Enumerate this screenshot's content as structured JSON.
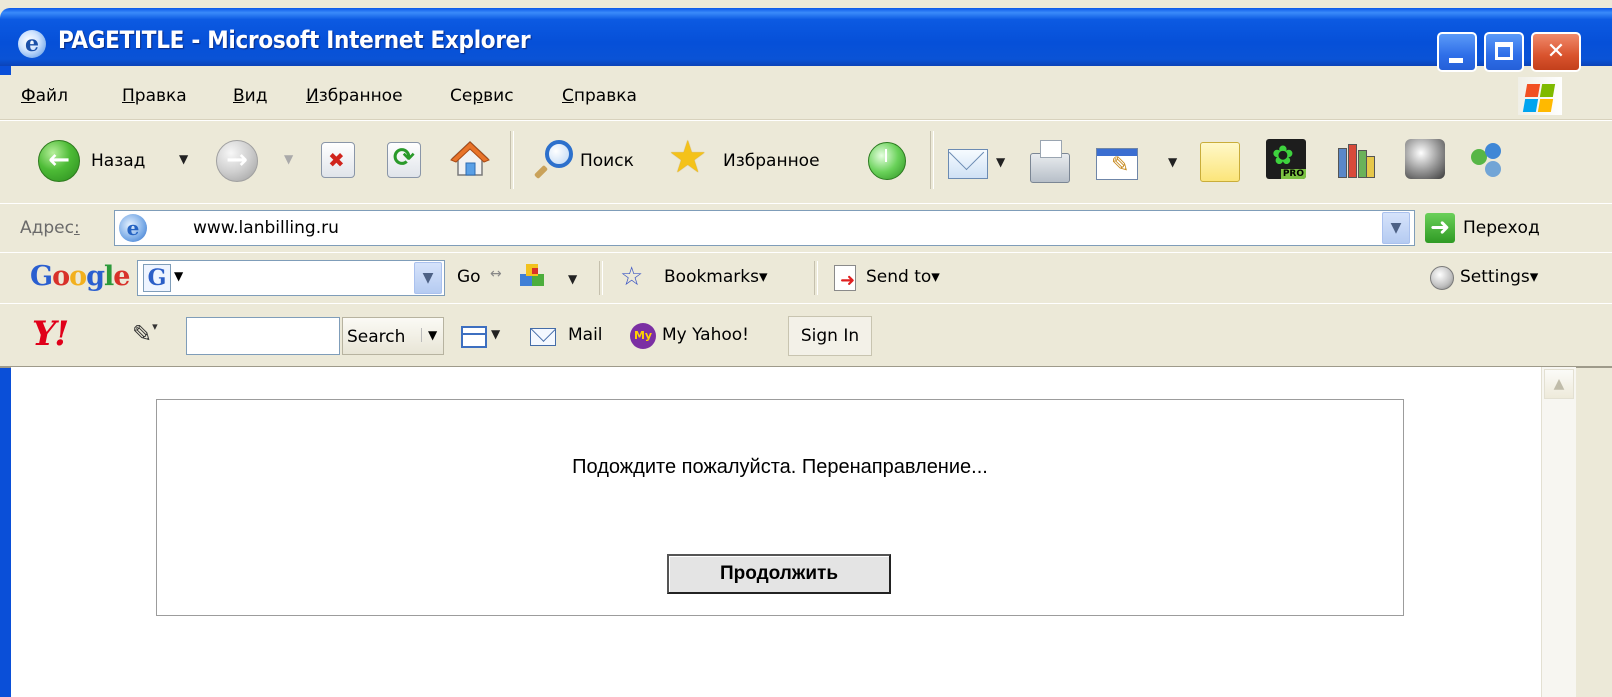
{
  "window": {
    "title": "PAGETITLE - Microsoft Internet Explorer",
    "title_icon": "ie-icon",
    "controls": [
      "minimize-icon",
      "maximize-icon",
      "close-icon"
    ]
  },
  "menu": {
    "items": [
      {
        "underline": "Ф",
        "rest": "айл"
      },
      {
        "underline": "П",
        "rest": "равка"
      },
      {
        "underline": "В",
        "rest": "ид"
      },
      {
        "underline": "И",
        "rest": "збранное"
      },
      {
        "pre": "Се",
        "underline": "р",
        "rest": "вис"
      },
      {
        "underline": "С",
        "rest": "правка"
      }
    ]
  },
  "toolbar": {
    "back_label": "Назад",
    "search_label": "Поиск",
    "favorites_label": "Избранное"
  },
  "address": {
    "label_pre": "Адрес",
    "label_ul": ":",
    "value": "www.lanbilling.ru",
    "go_label": "Переход"
  },
  "google": {
    "logo": "Google",
    "go_label": "Go",
    "bookmarks_label": "Bookmarks▾",
    "sendto_label": "Send to▾",
    "settings_label": "Settings▾"
  },
  "yahoo": {
    "logo": "Y!",
    "search_label": "Search",
    "mail_label": "Mail",
    "myyahoo_label": "My Yahoo!",
    "myyahoo_badge": "My",
    "signin_label": "Sign In"
  },
  "content": {
    "message": "Подождите пожалуйста. Перенаправление...",
    "continue_label": "Продолжить"
  },
  "colors": {
    "titlebar": "#0a53d6",
    "chrome": "#ece9d8",
    "close_button": "#d9532d",
    "content_bg": "#ffffff"
  }
}
